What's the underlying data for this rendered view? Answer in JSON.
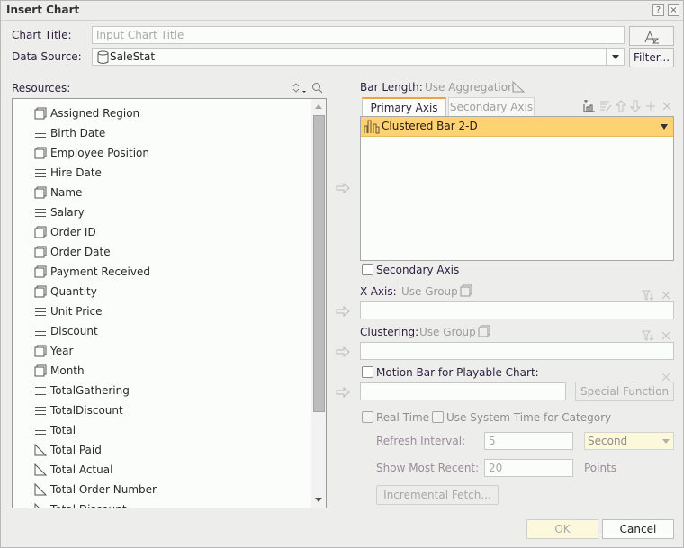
{
  "dialog": {
    "title": "Insert Chart",
    "help_icon": "?",
    "close_icon": "×"
  },
  "chart_title": {
    "label": "Chart Title:",
    "placeholder": "Input Chart Title",
    "value": "",
    "format_button_icon": "font-format-icon"
  },
  "data_source": {
    "label": "Data Source:",
    "value": "SaleStat",
    "icon": "database-icon",
    "filter_button": "Filter..."
  },
  "resources": {
    "label": "Resources:",
    "sort_icon": "sort-icon",
    "search_icon": "search-icon",
    "items": [
      {
        "label": "Assigned Region",
        "type": "group"
      },
      {
        "label": "Birth Date",
        "type": "detail"
      },
      {
        "label": "Employee Position",
        "type": "group"
      },
      {
        "label": "Hire Date",
        "type": "detail"
      },
      {
        "label": "Name",
        "type": "group"
      },
      {
        "label": "Salary",
        "type": "detail"
      },
      {
        "label": "Order ID",
        "type": "group"
      },
      {
        "label": "Order Date",
        "type": "group"
      },
      {
        "label": "Payment Received",
        "type": "group"
      },
      {
        "label": "Quantity",
        "type": "group"
      },
      {
        "label": "Unit Price",
        "type": "detail"
      },
      {
        "label": "Discount",
        "type": "detail"
      },
      {
        "label": "Year",
        "type": "group"
      },
      {
        "label": "Month",
        "type": "group"
      },
      {
        "label": "TotalGathering",
        "type": "detail"
      },
      {
        "label": "TotalDiscount",
        "type": "detail"
      },
      {
        "label": "Total",
        "type": "detail"
      },
      {
        "label": "Total Paid",
        "type": "aggregation"
      },
      {
        "label": "Total Actual",
        "type": "aggregation"
      },
      {
        "label": "Total Order Number",
        "type": "aggregation"
      },
      {
        "label": "Total Discount",
        "type": "aggregation"
      }
    ]
  },
  "bar_length": {
    "label": "Bar Length:",
    "hint": "Use Aggregation"
  },
  "axis_tabs": [
    {
      "label": "Primary Axis",
      "active": true
    },
    {
      "label": "Secondary Axis",
      "active": false
    }
  ],
  "series_toolbar": [
    "add-chart-icon",
    "edit-list-icon",
    "move-up-icon",
    "move-down-icon",
    "add-icon",
    "delete-icon"
  ],
  "series": {
    "selected": "Clustered Bar 2-D",
    "icon": "clustered-bar-icon"
  },
  "secondary_axis_checkbox": {
    "label": "Secondary Axis",
    "checked": false
  },
  "x_axis": {
    "label": "X-Axis:",
    "hint": "Use Group",
    "value": ""
  },
  "clustering": {
    "label": "Clustering:",
    "hint": "Use Group",
    "value": ""
  },
  "motion_bar": {
    "label": "Motion Bar for Playable Chart:",
    "checked": false,
    "value": "",
    "special_function_button": "Special Function"
  },
  "real_time": {
    "label": "Real Time",
    "checked": false
  },
  "use_system_time": {
    "label": "Use System Time for Category",
    "checked": false
  },
  "refresh_interval": {
    "label": "Refresh Interval:",
    "value": "5",
    "unit": "Second"
  },
  "show_most_recent": {
    "label": "Show Most Recent:",
    "value": "20",
    "unit": "Points"
  },
  "incremental_fetch_button": "Incremental Fetch...",
  "footer": {
    "ok": "OK",
    "cancel": "Cancel"
  },
  "colors": {
    "accent_orange": "#f0a04a",
    "selected_row": "#fcd273"
  }
}
